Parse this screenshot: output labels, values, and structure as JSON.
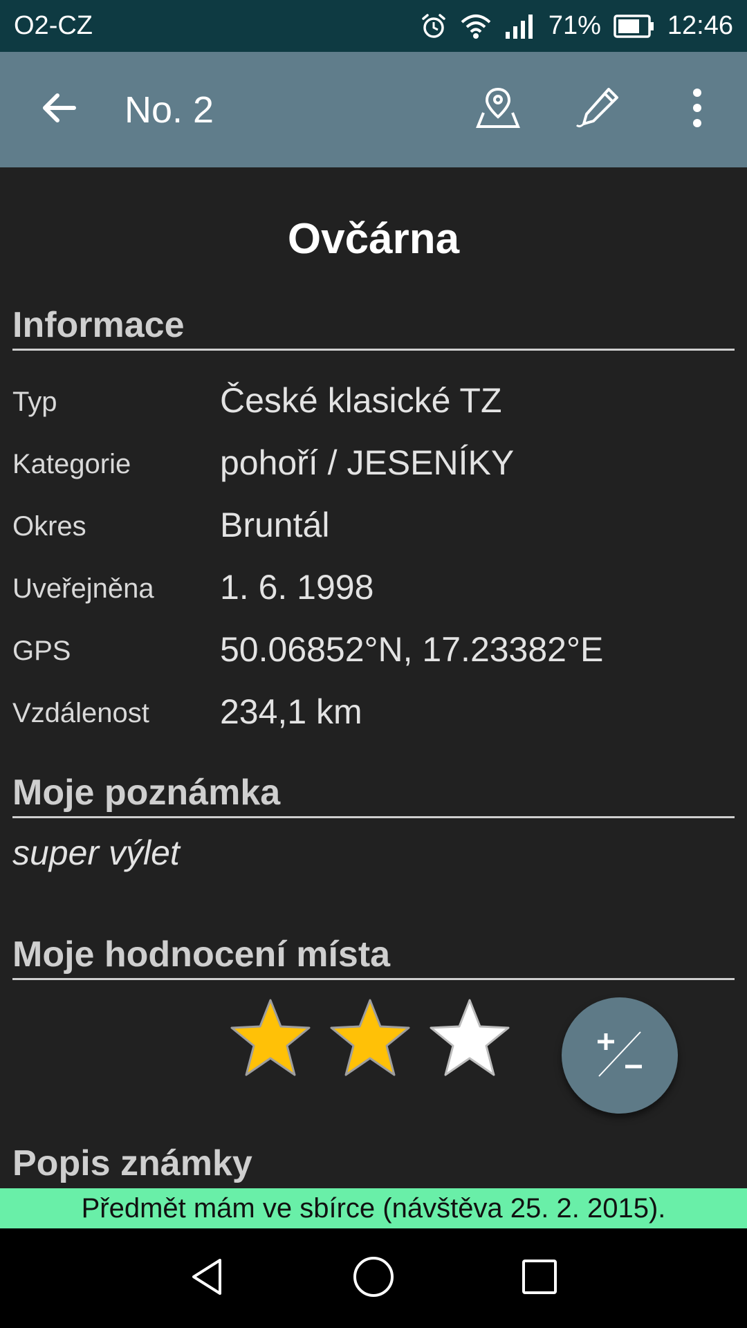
{
  "status_bar": {
    "carrier": "O2-CZ",
    "battery": "71%",
    "time": "12:46",
    "icons": [
      "alarm-icon",
      "wifi-icon",
      "signal-icon",
      "battery-icon"
    ]
  },
  "app_bar": {
    "title": "No. 2",
    "icons": [
      "back-arrow-icon",
      "map-pin-icon",
      "pencil-icon",
      "more-vert-icon"
    ],
    "color": "#607d8b"
  },
  "place": {
    "name": "Ovčárna"
  },
  "info": {
    "heading": "Informace",
    "rows": [
      {
        "label": "Typ",
        "value": "České klasické TZ"
      },
      {
        "label": "Kategorie",
        "value": "pohoří / JESENÍKY"
      },
      {
        "label": "Okres",
        "value": "Bruntál"
      },
      {
        "label": "Uveřejněna",
        "value": "1. 6. 1998"
      },
      {
        "label": "GPS",
        "value": "50.06852°N, 17.23382°E"
      },
      {
        "label": "Vzdálenost",
        "value": "234,1 km"
      }
    ]
  },
  "note": {
    "heading": "Moje poznámka",
    "text": "super výlet"
  },
  "rating": {
    "heading": "Moje hodnocení místa",
    "stars_filled": 2,
    "stars_total": 3,
    "filled_color": "#ffc107",
    "fab_icon": "plus-minus-icon"
  },
  "description": {
    "heading": "Popis známky"
  },
  "toast": {
    "text": "Předmět mám ve sbírce (návštěva 25. 2. 2015).",
    "color": "#69efa8"
  },
  "nav_bar": {
    "icons": [
      "nav-back-icon",
      "nav-home-icon",
      "nav-recents-icon"
    ]
  }
}
